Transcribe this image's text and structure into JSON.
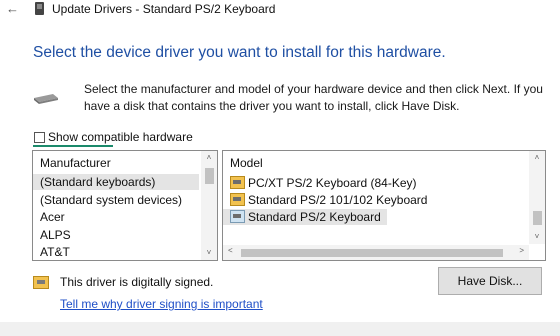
{
  "window": {
    "title": "Update Drivers - Standard PS/2 Keyboard",
    "back_icon": "←"
  },
  "heading": "Select the device driver you want to install for this hardware.",
  "instructions": "Select the manufacturer and model of your hardware device and then click Next. If you have a disk that contains the driver you want to install, click Have Disk.",
  "compatible": {
    "label": "Show compatible hardware",
    "checked": false
  },
  "manufacturer": {
    "header": "Manufacturer",
    "items": [
      "(Standard keyboards)",
      "(Standard system devices)",
      "Acer",
      "ALPS",
      "AT&T"
    ],
    "selected": "(Standard keyboards)"
  },
  "model": {
    "header": "Model",
    "items": [
      "PC/XT PS/2 Keyboard (84-Key)",
      "Standard PS/2 101/102 Keyboard",
      "Standard PS/2 Keyboard"
    ],
    "selected": "Standard PS/2 Keyboard"
  },
  "signed_text": "This driver is digitally signed.",
  "signing_link": "Tell me why driver signing is important",
  "have_disk_label": "Have Disk...",
  "scroll": {
    "up": "˄",
    "down": "˅",
    "left": "<",
    "right": ">"
  },
  "colors": {
    "heading": "#1f4fa3",
    "link": "#1f4fc7",
    "focus": "#1b8a6b",
    "selection": "#e4e4e4"
  }
}
